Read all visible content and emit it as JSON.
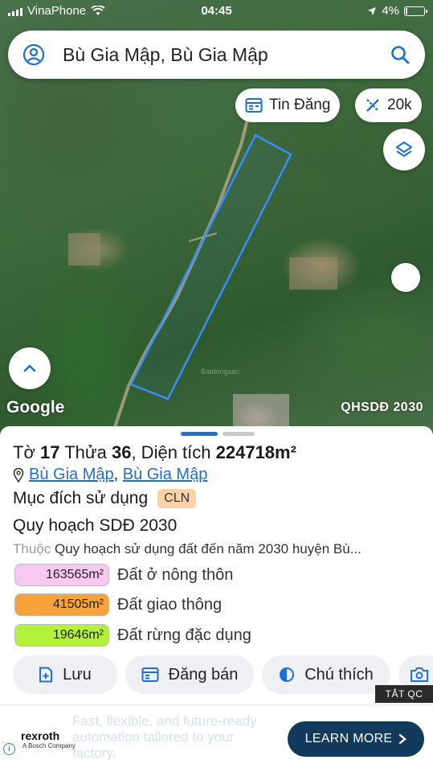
{
  "status_bar": {
    "carrier": "VinaPhone",
    "time": "04:45",
    "battery": "4%",
    "battery_level": 0.04
  },
  "search": {
    "text": "Bù Gia Mập, Bù Gia Mập",
    "icon": "search-icon",
    "user_icon": "user-icon"
  },
  "map": {
    "listing_button_label": "Tin Đăng",
    "scale_button_label": "20k",
    "google_label": "Google",
    "layer_label": "QHSDĐ 2030",
    "boundary_color": "#3a8dfc"
  },
  "sheet": {
    "title_prefix": "Tờ",
    "sheet_no": "17",
    "parcel_prefix": "Thửa",
    "parcel_no": "36",
    "area_prefix": ", Diện tích",
    "area": "224718m²",
    "commune": "Bù Gia Mập",
    "separator": ",",
    "district": "Bù Gia Mập",
    "usage_label": "Mục đích sử dụng",
    "usage_code": "CLN",
    "plan_title": "Quy hoạch SDĐ 2030",
    "plan_prefix": "Thuộc",
    "plan_desc": "Quy hoạch sử dụng đất đến năm 2030 huyện Bù...",
    "areas": [
      {
        "value": "163565m²",
        "label": "Đất ở nông thôn",
        "color": "#f7c8f2"
      },
      {
        "value": "41505m²",
        "label": "Đất giao thông",
        "color": "#f7a23b"
      },
      {
        "value": "19646m²",
        "label": "Đất rừng đặc dụng",
        "color": "#b4f23a"
      }
    ]
  },
  "actions": {
    "save": "Lưu",
    "post": "Đăng bán",
    "legend": "Chú thích"
  },
  "ad": {
    "hide_label": "TẮT QC",
    "brand": "rexroth",
    "brand_sub": "A Bosch Company",
    "copy": "Fast, flexible, and future-ready automation tailored to your factory.",
    "cta": "LEARN MORE"
  }
}
